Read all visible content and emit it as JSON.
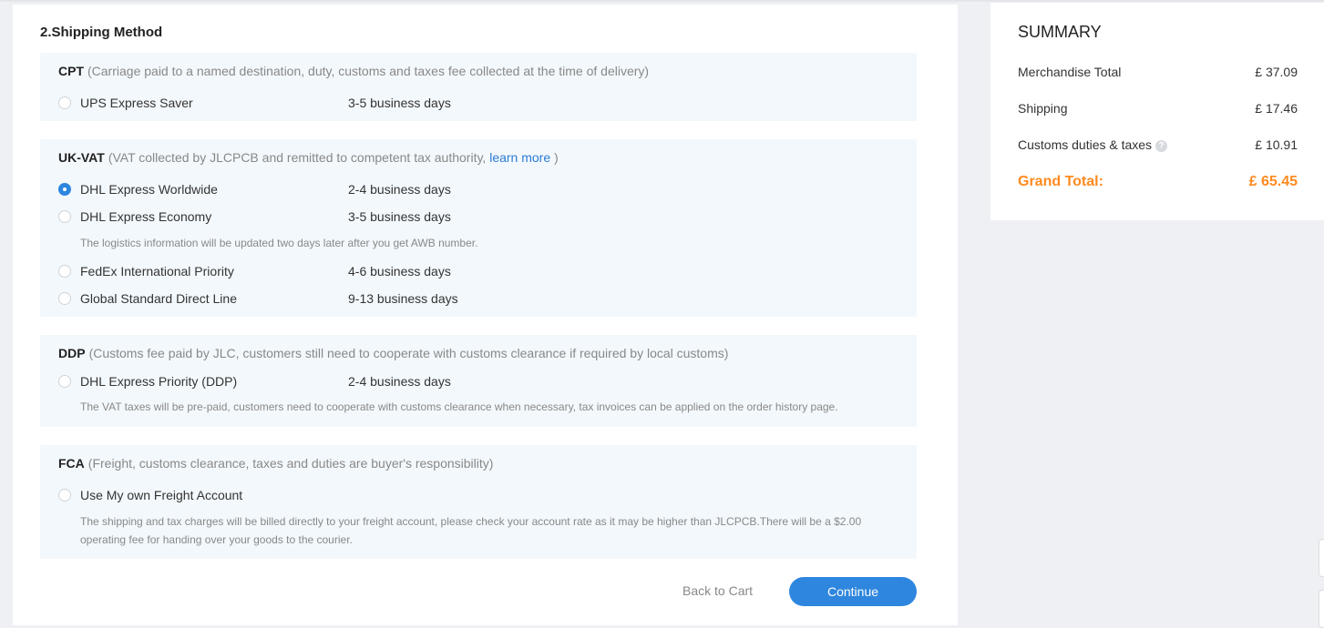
{
  "shipping": {
    "section_title": "2.Shipping Method",
    "groups": [
      {
        "code": "CPT",
        "desc": "(Carriage paid to a named destination, duty, customs and taxes fee collected at the time of delivery)",
        "options": [
          {
            "name": "UPS Express Saver",
            "days": "3-5 business days",
            "selected": false
          }
        ]
      },
      {
        "code": "UK-VAT",
        "desc": "(VAT collected by JLCPCB and remitted to competent tax authority,",
        "link": "learn more",
        "desc_end": ")",
        "options": [
          {
            "name": "DHL Express Worldwide",
            "days": "2-4 business days",
            "selected": true
          },
          {
            "name": "DHL Express Economy",
            "days": "3-5 business days",
            "selected": false
          },
          {
            "name": "FedEx International Priority",
            "days": "4-6 business days",
            "selected": false
          },
          {
            "name": "Global Standard Direct Line",
            "days": "9-13 business days",
            "selected": false
          }
        ],
        "note": "The logistics information will be updated two days later after you get AWB number."
      },
      {
        "code": "DDP",
        "desc": "(Customs fee paid by JLC, customers still need to cooperate with customs clearance if required by local customs)",
        "options": [
          {
            "name": "DHL Express Priority (DDP)",
            "days": "2-4 business days",
            "selected": false
          }
        ],
        "note": "The VAT taxes will be pre-paid, customers need to cooperate with customs clearance when necessary, tax invoices can be applied on the order history page."
      },
      {
        "code": "FCA",
        "desc": "(Freight, customs clearance, taxes and duties are buyer's responsibility)",
        "options": [
          {
            "name": "Use My own Freight Account",
            "days": "",
            "selected": false
          }
        ],
        "note_line1": "The shipping and tax charges will be billed directly to your freight account, please check your account rate as it may be higher than JLCPCB.There will be a $2.00",
        "note_line2": "operating fee for handing over your goods to the courier."
      }
    ],
    "back_label": "Back to Cart",
    "continue_label": "Continue"
  },
  "summary": {
    "title": "SUMMARY",
    "merch_label": "Merchandise Total",
    "merch_value": "£ 37.09",
    "shipping_label": "Shipping",
    "shipping_value": "£ 17.46",
    "duties_label": "Customs duties & taxes",
    "duties_value": "£ 10.91",
    "help_glyph": "?",
    "grand_label": "Grand Total:",
    "grand_value": "£ 65.45"
  },
  "colors": {
    "accent": "#2e86de",
    "grand_total": "#ff8a1f",
    "group_bg": "#f3f8fc"
  }
}
